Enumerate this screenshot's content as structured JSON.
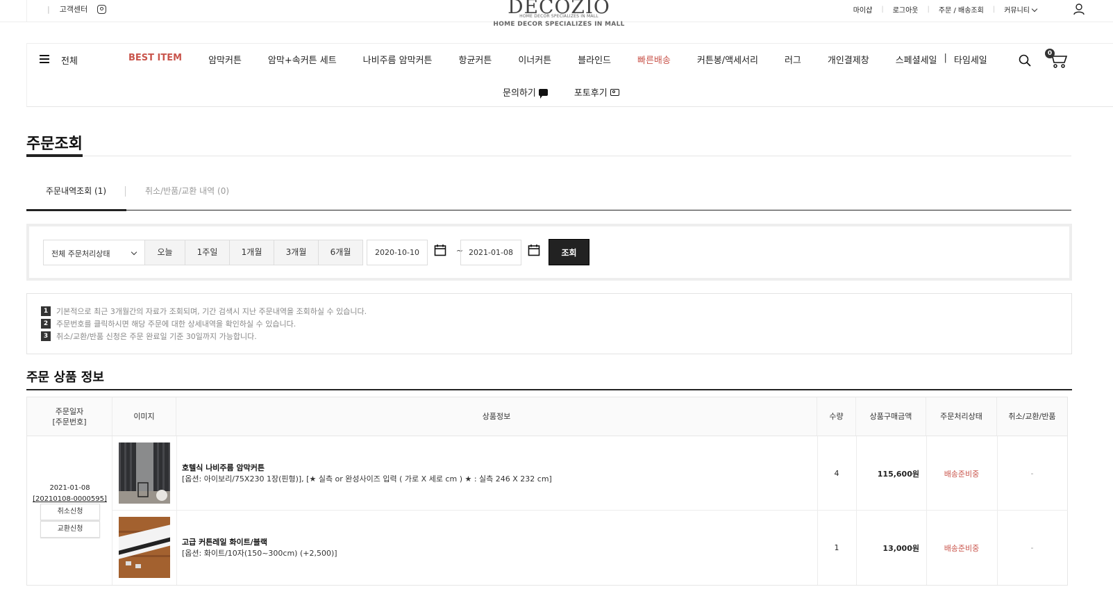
{
  "topbar": {
    "customer_center": "고객센터",
    "logo_word": "DECOZIO",
    "logo_tagline": "HOME DECOR SPECIALIZES IN MALL",
    "logo_tagline_large": "HOME DECOR SPECIALIZES IN MALL",
    "links": [
      "마이샵",
      "로그아웃",
      "주문 / 배송조회",
      "커뮤니티"
    ]
  },
  "nav": {
    "all_label": "전체",
    "items": [
      "BEST ITEM",
      "암막커튼",
      "암막+속커튼 세트",
      "나비주름 암막커튼",
      "항균커튼",
      "이너커튼",
      "블라인드",
      "빠른배송",
      "커튼봉/액세서리",
      "러그",
      "개인결제창",
      "스페셜세일",
      "타임세일"
    ],
    "bar": "|",
    "secondary": [
      "문의하기",
      "포토후기"
    ],
    "cart_count": "0",
    "highlight_color": "#c9554c"
  },
  "page": {
    "title": "주문조회",
    "tabs": [
      "주문내역조회 (1)",
      "취소/반품/교환 내역 (0)"
    ]
  },
  "search": {
    "status_select": "전체 주문처리상태",
    "periods": [
      "오늘",
      "1주일",
      "1개월",
      "3개월",
      "6개월"
    ],
    "date_from": "2020-10-10",
    "tilde": "~",
    "date_to": "2021-01-08",
    "query_button": "조회"
  },
  "notes": [
    {
      "num": "1",
      "text": "기본적으로 최근 3개월간의 자료가 조회되며, 기간 검색시 지난 주문내역을 조회하실 수 있습니다."
    },
    {
      "num": "2",
      "text": "주문번호를 클릭하시면 해당 주문에 대한 상세내역을 확인하실 수 있습니다."
    },
    {
      "num": "3",
      "text": "취소/교환/반품 신청은 주문 완료일 기준 30일까지 가능합니다."
    }
  ],
  "orders": {
    "section_title": "주문 상품 정보",
    "headers": {
      "date_line1": "주문일자",
      "date_line2": "[주문번호]",
      "image": "이미지",
      "info": "상품정보",
      "qty": "수량",
      "amount": "상품구매금액",
      "status": "주문처리상태",
      "action": "취소/교환/반품"
    },
    "order_date": "2021-01-08",
    "order_no": "[20210108-0000595]",
    "cancel_button": "취소신청",
    "exchange_button": "교환신청",
    "items": [
      {
        "name": "호텔식 나비주름 암막커튼",
        "option": "[옵션: 아이보리/75X230 1장(핀형)], [★ 실측 or 완성사이즈 입력 ( 가로 X 세로 cm ) ★ : 실측 246 X 232 cm]",
        "qty": "4",
        "price": "115,600원",
        "status": "배송준비중",
        "action": "-"
      },
      {
        "name": "고급 커튼레일 화이트/블랙",
        "option": "[옵션: 화이트/10자(150~300cm) (+2,500)]",
        "qty": "1",
        "price": "13,000원",
        "status": "배송준비중",
        "action": "-"
      }
    ]
  }
}
